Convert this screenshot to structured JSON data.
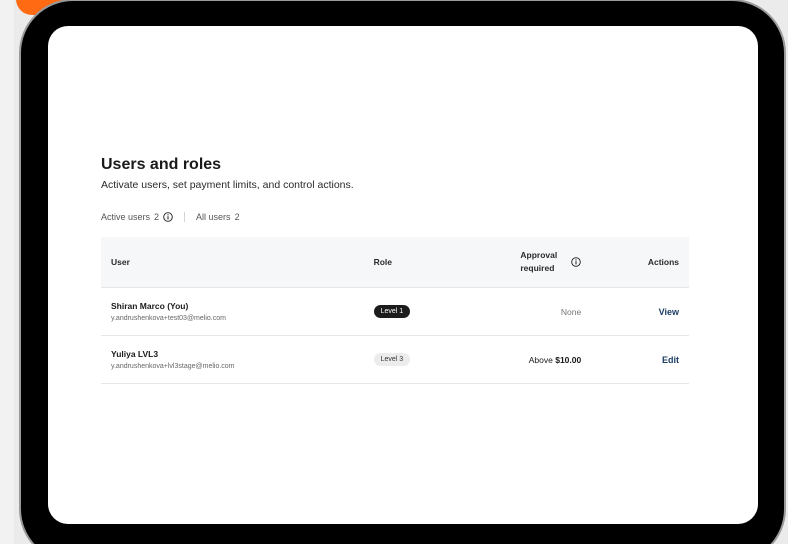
{
  "page": {
    "title": "Users and roles",
    "subtitle": "Activate users, set payment limits, and control actions."
  },
  "filters": {
    "active_label": "Active users",
    "active_count": "2",
    "all_label": "All users",
    "all_count": "2"
  },
  "table": {
    "headers": {
      "user": "User",
      "role": "Role",
      "approval_line1": "Approval",
      "approval_line2": "required",
      "actions": "Actions"
    },
    "rows": [
      {
        "name": "Shiran Marco (You)",
        "email": "y.andrushenkova+test03@melio.com",
        "role": "Level 1",
        "approval": "None",
        "action": "View"
      },
      {
        "name": "Yuliya LVL3",
        "email": "y.andrushenkova+lvl3stage@melio.com",
        "role": "Level 3",
        "approval_prefix": "Above",
        "approval_amount": "$10.00",
        "action": "Edit"
      }
    ]
  },
  "icons": {
    "info": "info-circle-icon"
  },
  "colors": {
    "accent_orange": "#ff6a13",
    "action_link": "#1c3d63",
    "badge_dark": "#1c1c1c",
    "badge_light": "#ececec",
    "header_bg": "#f6f7f9"
  }
}
